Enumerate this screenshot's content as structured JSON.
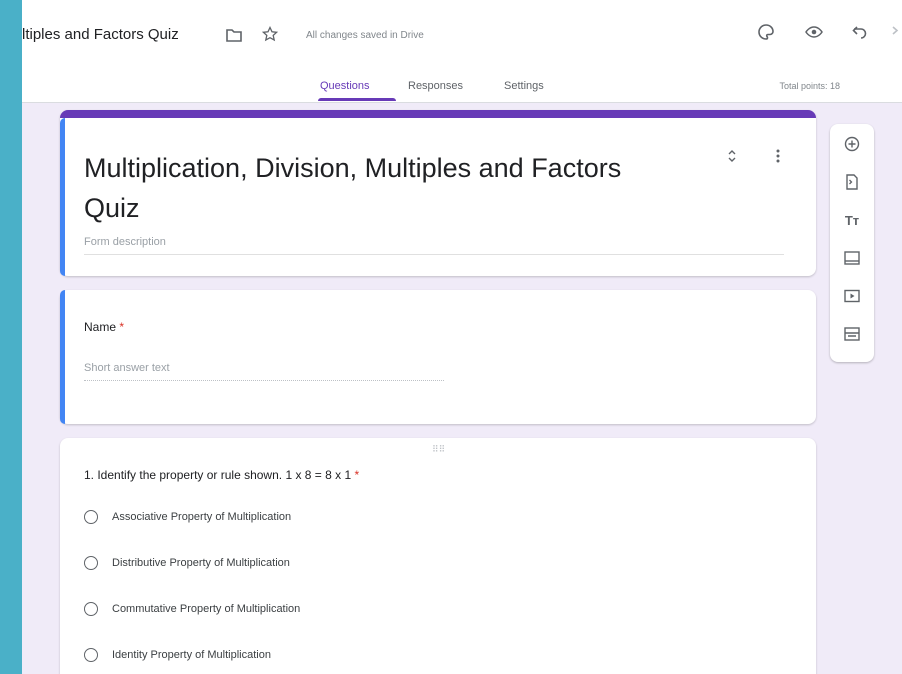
{
  "header": {
    "doc_title": "ltiples and Factors Quiz",
    "saved_status": "All changes saved in Drive",
    "icons": [
      "folder-icon",
      "star-icon",
      "palette-icon",
      "preview-eye-icon",
      "undo-icon"
    ]
  },
  "tabs": [
    {
      "label": "Questions",
      "active": true
    },
    {
      "label": "Responses",
      "active": false
    },
    {
      "label": "Settings",
      "active": false
    }
  ],
  "total_points": "Total points: 18",
  "form": {
    "title": "Multiplication, Division, Multiples and Factors Quiz",
    "description_placeholder": "Form description"
  },
  "name_question": {
    "label": "Name",
    "required_mark": "*",
    "answer_placeholder": "Short answer text"
  },
  "question1": {
    "text": "1.  Identify the property or rule shown. 1 x 8 = 8 x 1",
    "required_mark": "*",
    "options": [
      "Associative Property of Multiplication",
      "Distributive Property of Multiplication",
      "Commutative Property of Multiplication",
      "Identity Property of Multiplication"
    ]
  },
  "sidebar_tools": [
    "add-question-icon",
    "import-questions-icon",
    "add-title-icon",
    "add-image-icon",
    "add-video-icon",
    "add-section-icon"
  ],
  "colors": {
    "accent": "#673ab7",
    "focus": "#4285f4",
    "page_bg": "#f0ebf8",
    "outer_bg": "#4ab0c8"
  }
}
